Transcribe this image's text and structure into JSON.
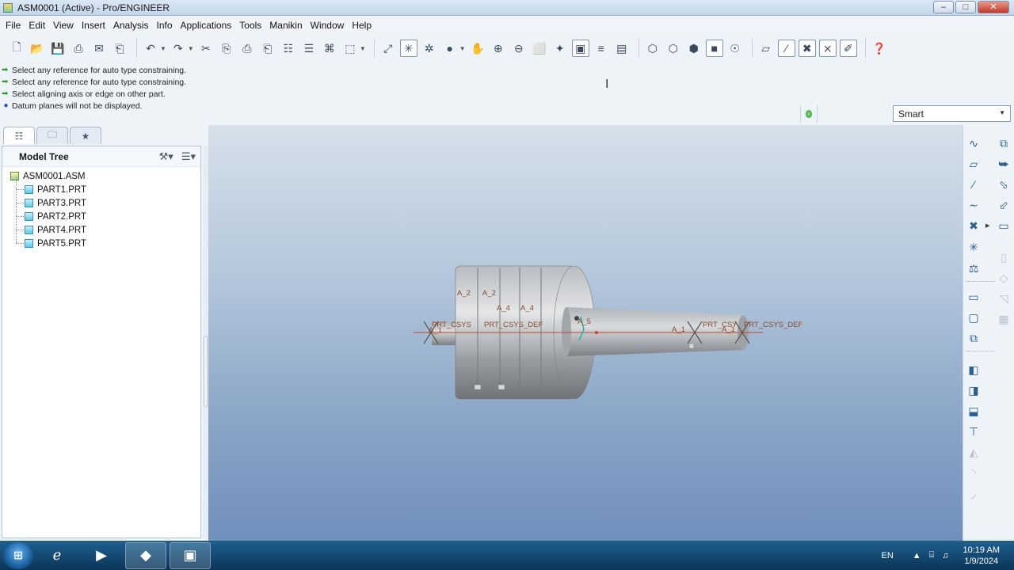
{
  "window": {
    "title": "ASM0001 (Active) - Pro/ENGINEER",
    "buttons": {
      "minimize": "–",
      "restore": "□",
      "close": "✕"
    }
  },
  "menubar": {
    "items": [
      "File",
      "Edit",
      "View",
      "Insert",
      "Analysis",
      "Info",
      "Applications",
      "Tools",
      "Manikin",
      "Window",
      "Help"
    ]
  },
  "toolbar": {
    "icons": [
      "new-file-icon",
      "open-file-icon",
      "save-icon",
      "print-icon",
      "mail-icon",
      "send-icon",
      "undo-icon",
      "redo-icon",
      "cut-icon",
      "copy-icon",
      "paste-icon",
      "paste-special-icon",
      "regenerate-icon",
      "regen-manager-icon",
      "find-icon",
      "select-box-icon",
      "refit-icon",
      "spin-center-icon",
      "orient-icon",
      "shading-icon",
      "pan-icon",
      "zoom-in-icon",
      "zoom-out-icon",
      "zoom-fit-icon",
      "orientation-icon",
      "saved-views-icon",
      "layers-icon",
      "view-manager-icon",
      "wireframe-icon",
      "hidden-line-icon",
      "no-hidden-icon",
      "shaded-icon",
      "enhanced-realism-icon",
      "datum-planes-icon",
      "datum-axes-icon",
      "datum-points-icon",
      "csys-icon",
      "annotation-icon",
      "help-icon"
    ]
  },
  "messages": [
    {
      "type": "prompt",
      "text": "Select any reference for auto type constraining."
    },
    {
      "type": "prompt",
      "text": "Select any reference for auto type constraining."
    },
    {
      "type": "prompt",
      "text": "Select aligning axis or edge on other part."
    },
    {
      "type": "info",
      "text": "Datum planes will not be displayed."
    }
  ],
  "filter": {
    "selected": "Smart"
  },
  "navigator": {
    "tabs": [
      "model-tree-tab",
      "folder-browser-tab",
      "favorites-tab"
    ],
    "model_tree": {
      "title": "Model Tree",
      "root": "ASM0001.ASM",
      "children": [
        "PART1.PRT",
        "PART3.PRT",
        "PART2.PRT",
        "PART4.PRT",
        "PART5.PRT"
      ]
    }
  },
  "graphics": {
    "datum_labels": [
      "A_2",
      "A_2",
      "A_4",
      "A_4",
      "PRT_CSYS",
      "A_1",
      "PRT_CSYS_DEF",
      "A_5",
      "A_1",
      "PRT_CSY",
      "PRT_CSYS_DEF",
      "A_1"
    ]
  },
  "taskbar": {
    "apps": [
      "ie-icon",
      "media-player-icon",
      "proe-icon",
      "app-window-icon"
    ],
    "language": "EN",
    "time": "10:19 AM",
    "date": "1/9/2024"
  },
  "colors": {
    "accent": "#2a5f8f",
    "datum_label": "#8b4a2c",
    "prompt_arrow": "#2a9d2a",
    "taskbar": "#0c3559"
  }
}
